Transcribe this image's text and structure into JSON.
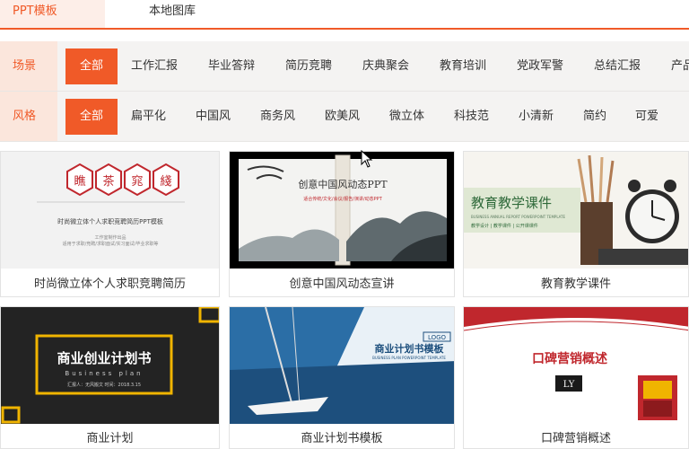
{
  "tabs": {
    "ppt": "PPT模板",
    "local": "本地图库"
  },
  "filters": {
    "scene_label": "场景",
    "scene_items": [
      "全部",
      "工作汇报",
      "毕业答辩",
      "简历竞聘",
      "庆典聚会",
      "教育培训",
      "党政军警",
      "总结汇报",
      "产品"
    ],
    "style_label": "风格",
    "style_items": [
      "全部",
      "扁平化",
      "中国风",
      "商务风",
      "欧美风",
      "微立体",
      "科技范",
      "小清新",
      "简约",
      "可爱"
    ],
    "active_color": "#f05a28"
  },
  "cards": [
    {
      "caption": "时尚微立体个人求职竞聘简历",
      "thumb": {
        "hex_chars": [
          "瞧",
          "茶",
          "窕",
          "綫"
        ],
        "line1": "时尚微立体个人求职竞聘简历PPT模板",
        "line2": "工作室制作出品",
        "line3": "适用于求职/竞聘/求职面试/实习面试/毕业求职等"
      }
    },
    {
      "caption": "创意中国风动态宣讲",
      "thumb": {
        "title": "创意中国风动态PPT",
        "subtitle": "适合传统/文化/会议/报告/演讲/动态PPT"
      }
    },
    {
      "caption": "教育教学课件",
      "thumb": {
        "title": "教育教学课件",
        "sub": "BUSINESS ANNUAL REPORT POWERPOINT TEMPLATE",
        "tags": "教学设计 | 教学课件 | 公开课课件"
      }
    },
    {
      "caption": "商业计划",
      "thumb": {
        "title": "商业创业计划书",
        "en": "Business plan",
        "meta": "汇报人：无风搬文    时间：2018.3.15"
      }
    },
    {
      "caption": "商业计划书模板",
      "thumb": {
        "logo": "LOGO",
        "title": "商业计划书模板",
        "sub": "BUSINESS PLAN POWERPOINT TEMPLATE"
      }
    },
    {
      "caption": "口碑营销概述",
      "thumb": {
        "title": "口碑营销概述",
        "logo": "LY"
      }
    }
  ]
}
